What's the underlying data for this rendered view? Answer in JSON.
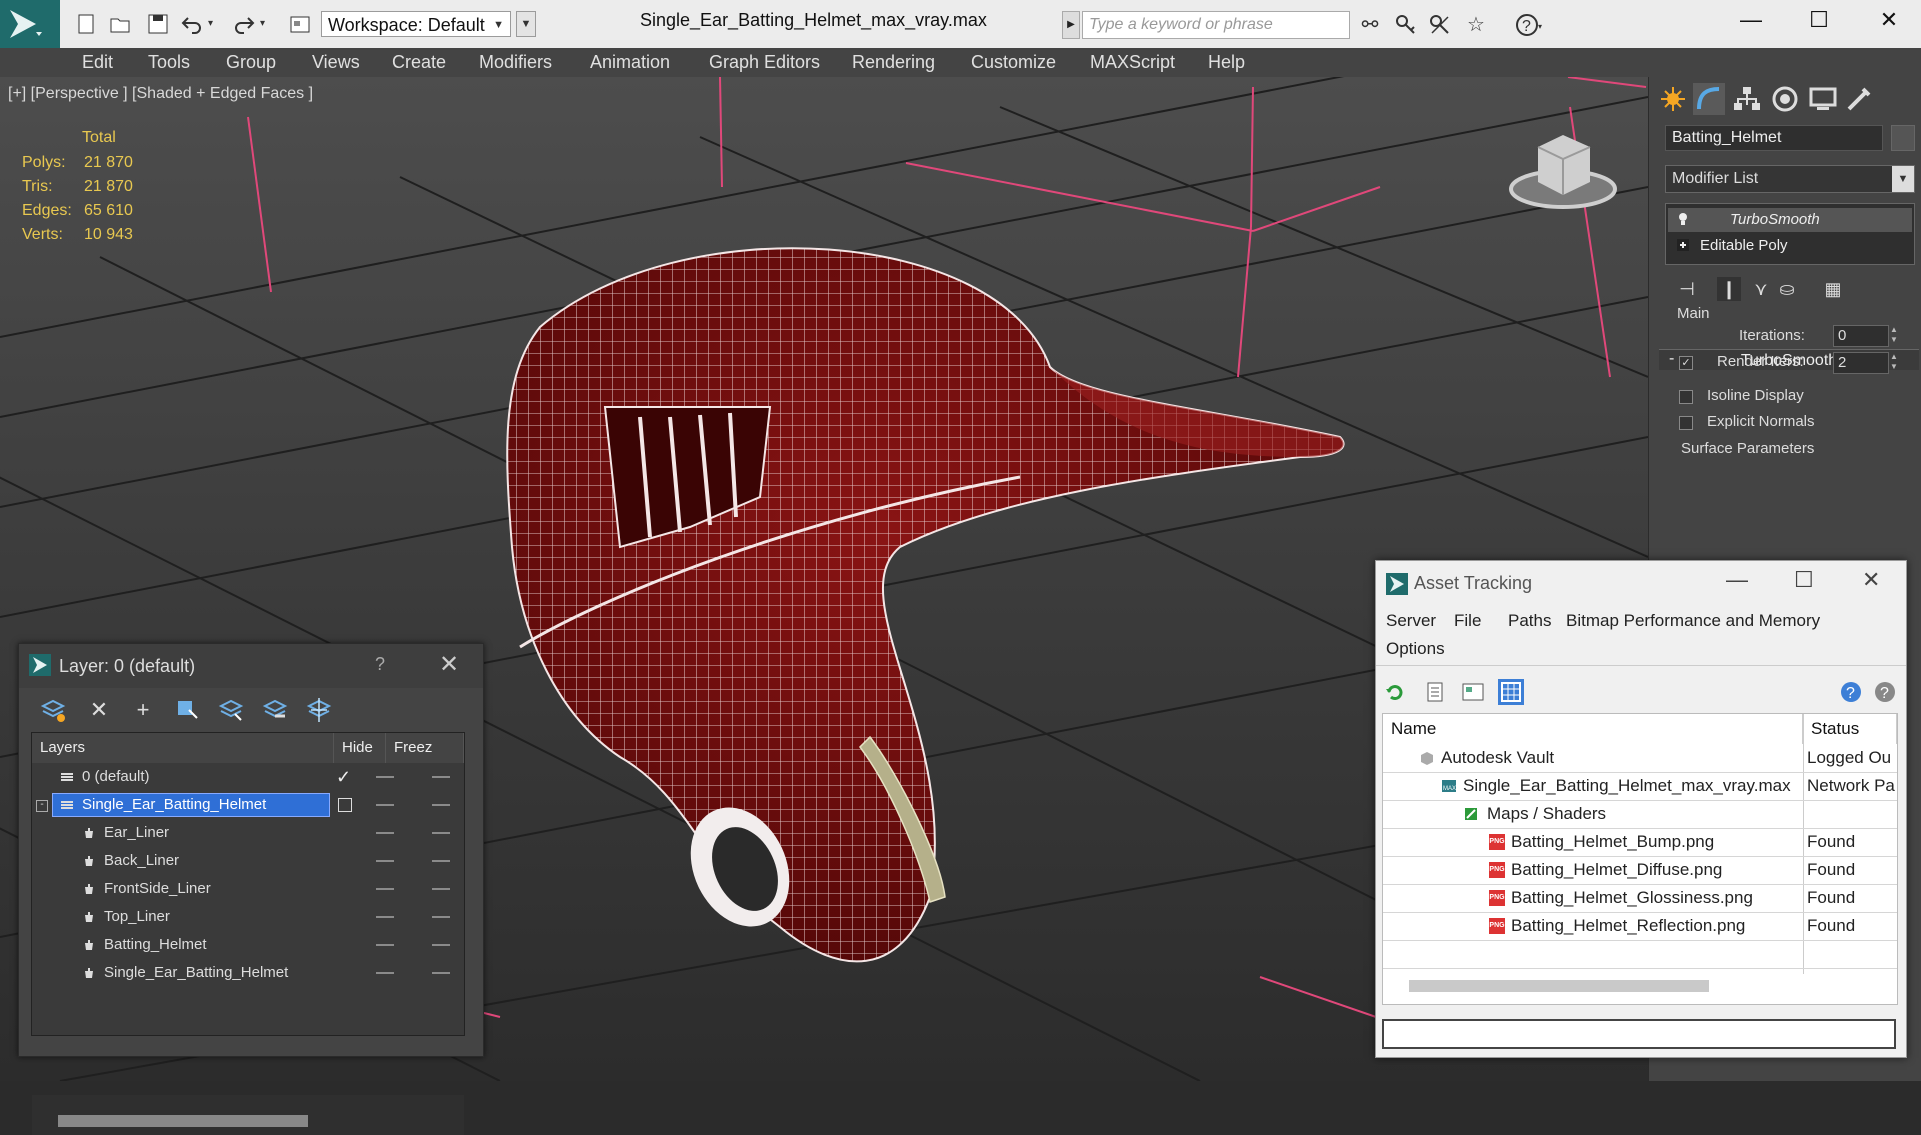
{
  "window": {
    "title": "Single_Ear_Batting_Helmet_max_vray.max",
    "workspace": "Workspace: Default",
    "search_placeholder": "Type a keyword or phrase",
    "controls": [
      "minimize",
      "maximize",
      "close"
    ]
  },
  "menu": [
    "Edit",
    "Tools",
    "Group",
    "Views",
    "Create",
    "Modifiers",
    "Animation",
    "Graph Editors",
    "Rendering",
    "Customize",
    "MAXScript",
    "Help"
  ],
  "viewport": {
    "label": "[+] [Perspective ] [Shaded + Edged Faces ]",
    "stats": {
      "header": "Total",
      "rows": [
        {
          "label": "Polys:",
          "value": "21 870"
        },
        {
          "label": "Tris:",
          "value": "21 870"
        },
        {
          "label": "Edges:",
          "value": "65 610"
        },
        {
          "label": "Verts:",
          "value": "10 943"
        }
      ]
    },
    "colors": {
      "helmet": "#6e0c0c",
      "wire": "#f0e0e0",
      "bbox": "#e0487a",
      "liner": "#b5b08a"
    }
  },
  "command_panel": {
    "object_name": "Batting_Helmet",
    "modifier_list": "Modifier List",
    "stack": [
      {
        "label": "TurboSmooth",
        "italic": true
      },
      {
        "label": "Editable Poly",
        "italic": false
      }
    ],
    "rollout": {
      "title": "TurboSmooth",
      "group": "Main",
      "iterations_label": "Iterations:",
      "iterations": "0",
      "render_iters_label": "Render Iters:",
      "render_iters": "2",
      "render_iters_checked": true,
      "isoline_label": "Isoline Display",
      "explicit_label": "Explicit Normals",
      "surface_label": "Surface Parameters"
    }
  },
  "layer_dialog": {
    "title": "Layer: 0 (default)",
    "help": "?",
    "columns": [
      "Layers",
      "Hide",
      "Freez"
    ],
    "rows": [
      {
        "name": "0 (default)",
        "indent": 0,
        "type": "layer",
        "active": true
      },
      {
        "name": "Single_Ear_Batting_Helmet",
        "indent": 0,
        "type": "layer",
        "selected": true
      },
      {
        "name": "Ear_Liner",
        "indent": 1,
        "type": "object"
      },
      {
        "name": "Back_Liner",
        "indent": 1,
        "type": "object"
      },
      {
        "name": "FrontSide_Liner",
        "indent": 1,
        "type": "object"
      },
      {
        "name": "Top_Liner",
        "indent": 1,
        "type": "object"
      },
      {
        "name": "Batting_Helmet",
        "indent": 1,
        "type": "object"
      },
      {
        "name": "Single_Ear_Batting_Helmet",
        "indent": 1,
        "type": "object"
      }
    ]
  },
  "asset_tracking": {
    "title": "Asset Tracking",
    "menu": [
      "Server",
      "File",
      "Paths",
      "Bitmap Performance and Memory",
      "Options"
    ],
    "columns": [
      "Name",
      "Status"
    ],
    "rows": [
      {
        "name": "Autodesk Vault",
        "status": "Logged Ou",
        "indent": 1,
        "icon": "vault-icon"
      },
      {
        "name": "Single_Ear_Batting_Helmet_max_vray.max",
        "status": "Network Pa",
        "indent": 2,
        "icon": "max-file-icon"
      },
      {
        "name": "Maps / Shaders",
        "status": "",
        "indent": 3,
        "icon": "maps-icon"
      },
      {
        "name": "Batting_Helmet_Bump.png",
        "status": "Found",
        "indent": 4,
        "icon": "png-icon"
      },
      {
        "name": "Batting_Helmet_Diffuse.png",
        "status": "Found",
        "indent": 4,
        "icon": "png-icon"
      },
      {
        "name": "Batting_Helmet_Glossiness.png",
        "status": "Found",
        "indent": 4,
        "icon": "png-icon"
      },
      {
        "name": "Batting_Helmet_Reflection.png",
        "status": "Found",
        "indent": 4,
        "icon": "png-icon"
      }
    ]
  }
}
